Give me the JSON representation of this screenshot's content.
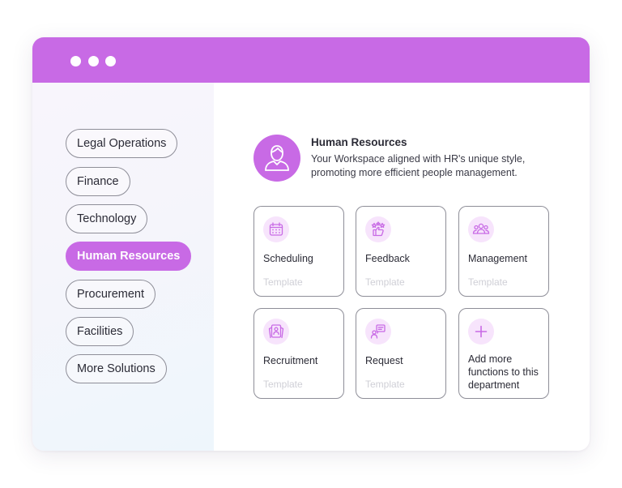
{
  "sidebar": {
    "items": [
      {
        "label": "Legal Operations",
        "active": false
      },
      {
        "label": "Finance",
        "active": false
      },
      {
        "label": "Technology",
        "active": false
      },
      {
        "label": "Human Resources",
        "active": true
      },
      {
        "label": "Procurement",
        "active": false
      },
      {
        "label": "Facilities",
        "active": false
      },
      {
        "label": "More Solutions",
        "active": false
      }
    ]
  },
  "header": {
    "icon": "person-avatar-icon",
    "title": "Human Resources",
    "description": "Your Workspace aligned with HR's unique style, promoting more efficient people management."
  },
  "cards": [
    {
      "name": "Scheduling",
      "sub": "Template",
      "icon": "calendar-icon"
    },
    {
      "name": "Feedback",
      "sub": "Template",
      "icon": "thumbs-up-stars-icon"
    },
    {
      "name": "Management",
      "sub": "Template",
      "icon": "team-icon"
    },
    {
      "name": "Recruitment",
      "sub": "Template",
      "icon": "id-badge-icon"
    },
    {
      "name": "Request",
      "sub": "Template",
      "icon": "chat-request-icon"
    },
    {
      "name": "Add more functions to this department",
      "icon": "plus-icon"
    }
  ],
  "colors": {
    "accent": "#c86ae5",
    "icon_bg": "#f7e4fc",
    "border": "#8e8e98"
  }
}
